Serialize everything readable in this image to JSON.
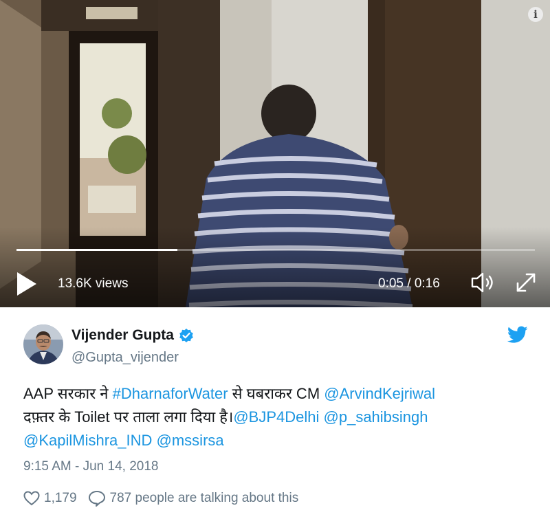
{
  "video": {
    "views": "13.6K views",
    "time": "0:05 / 0:16",
    "progress": 0.31,
    "info_glyph": "i",
    "icons": [
      "info-icon",
      "play-icon",
      "volume-icon",
      "expand-icon"
    ]
  },
  "tweet": {
    "author_name": "Vijender Gupta",
    "handle": "@Gupta_vijender",
    "verified_icon": "verified-badge-icon",
    "platform_icon": "twitter-bird-icon",
    "text_parts": {
      "p1": "AAP सरकार ने ",
      "hashtag": "#DharnaforWater",
      "p2": " से घबराकर CM ",
      "mention1": "@ArvindKejriwal",
      "p3": "दफ़्तर के Toilet पर ताला लगा दिया है।",
      "mention2": "@BJP4Delhi",
      "mention3": "@p_sahibsingh",
      "mention4": "@KapilMishra_IND",
      "mention5": "@mssirsa"
    },
    "timestamp": "9:15 AM - Jun 14, 2018",
    "likes": "1,179",
    "talking": "787 people are talking about this"
  },
  "colors": {
    "link": "#1b95e0",
    "muted": "#657786",
    "verified": "#1da1f2"
  }
}
